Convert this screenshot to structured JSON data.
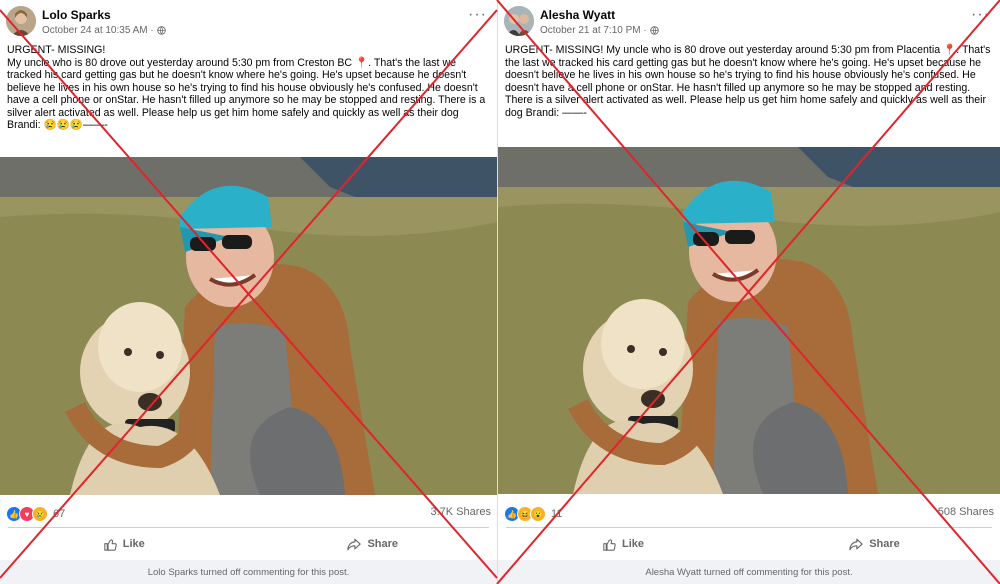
{
  "colors": {
    "cross": "#e0242b",
    "like": "#1877f2",
    "meta": "#65676b"
  },
  "icons": {
    "globe": "globe-icon",
    "more": "more-options-icon",
    "like": "thumbs-up-icon",
    "share": "share-arrow-icon"
  },
  "posts": [
    {
      "author": "Lolo Sparks",
      "meta": "October 24 at 10:35 AM · ",
      "body": "URGENT- MISSING!\nMy uncle who is 80 drove out yesterday around 5:30 pm from  Creston BC 📍.  That's the last we tracked his card getting gas but he doesn't know where he's going.  He's upset because he doesn't believe he lives in his own house so he's trying to find his house obviously he's confused.  He doesn't have a cell phone or onStar. He hasn't filled up anymore so he may be stopped and resting. There is a silver alert activated as well. Please help us get him home safely and quickly as well as their dog Brandi:  😢😢😢——-",
      "reaction_count": "67",
      "shares": "3.7K Shares",
      "like_label": "Like",
      "share_label": "Share",
      "notice": "Lolo Sparks turned off commenting for this post."
    },
    {
      "author": "Alesha Wyatt",
      "meta": "October 21 at 7:10 PM · ",
      "body": "URGENT- MISSING! My uncle who is 80 drove out yesterday around 5:30 pm from  Placentia 📍.  That's the last we tracked his card getting gas but he doesn't know where he's going.  He's upset because he doesn't believe he lives in his own house so he's trying to find his house obviously he's confused.  He doesn't have a cell phone or onStar. He hasn't filled up anymore so he may be stopped and resting. There is a silver alert activated as well. Please help us get him home safely and quickly as well as their dog Brandi:  ——-",
      "reaction_count": "11",
      "shares": "508 Shares",
      "like_label": "Like",
      "share_label": "Share",
      "notice": "Alesha Wyatt turned off commenting for this post."
    }
  ]
}
